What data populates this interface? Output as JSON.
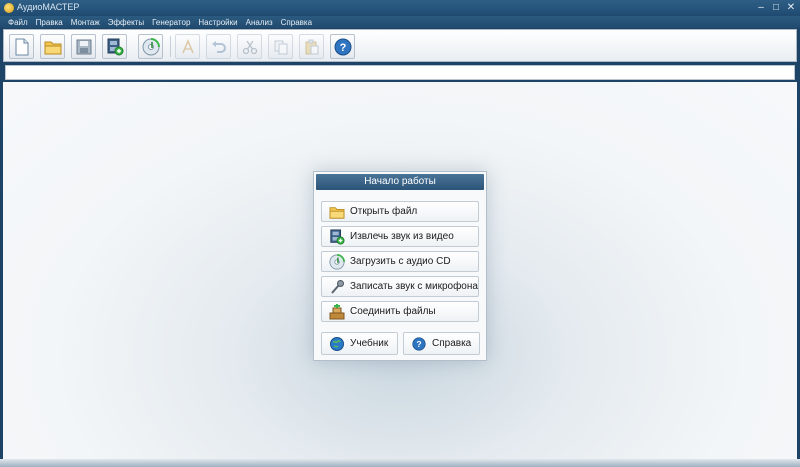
{
  "window": {
    "title": "АудиоМАСТЕР",
    "controls": {
      "minimize": "–",
      "maximize": "□",
      "close": "✕"
    }
  },
  "menu": {
    "items": [
      "Файл",
      "Правка",
      "Монтаж",
      "Эффекты",
      "Генератор",
      "Настройки",
      "Анализ",
      "Справка"
    ]
  },
  "toolbar": {
    "buttons": [
      {
        "icon": "new-file-icon",
        "enabled": true
      },
      {
        "icon": "open-folder-icon",
        "enabled": true
      },
      {
        "icon": "save-icon",
        "enabled": true
      },
      {
        "icon": "extract-from-video-icon",
        "enabled": true
      },
      {
        "icon": "load-cd-icon",
        "enabled": true
      },
      {
        "icon": "mark-icon",
        "enabled": false
      },
      {
        "icon": "undo-icon",
        "enabled": false
      },
      {
        "icon": "cut-icon",
        "enabled": false
      },
      {
        "icon": "copy-icon",
        "enabled": false
      },
      {
        "icon": "paste-icon",
        "enabled": false
      },
      {
        "icon": "help-icon",
        "enabled": true
      }
    ]
  },
  "start_panel": {
    "title": "Начало работы",
    "buttons": [
      {
        "label": "Открыть файл",
        "icon": "open-folder-icon"
      },
      {
        "label": "Извлечь звук из видео",
        "icon": "extract-from-video-icon"
      },
      {
        "label": "Загрузить с аудио CD",
        "icon": "load-cd-icon"
      },
      {
        "label": "Записать звук с микрофона",
        "icon": "microphone-icon"
      },
      {
        "label": "Соединить файлы",
        "icon": "join-files-icon"
      }
    ],
    "tutorial_label": "Учебник",
    "help_label": "Справка"
  },
  "colors": {
    "titlebar": "#1f4a70",
    "panel_header": "#2b5479",
    "workspace": "#f3f6f8"
  }
}
